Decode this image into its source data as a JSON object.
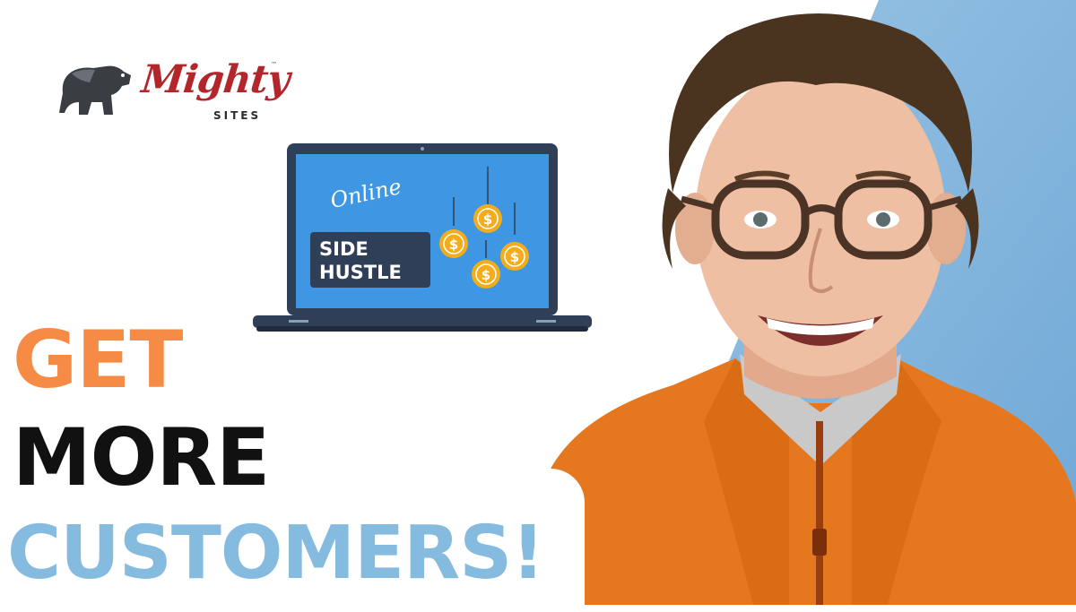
{
  "colors": {
    "brand_red": "#b3262b",
    "orange": "#f58b45",
    "black": "#111111",
    "light_blue": "#86bbe0",
    "screen_blue": "#3f97e3",
    "laptop_dark": "#2f3f57",
    "coin_gold": "#f3ad1c",
    "jacket_orange": "#e5781e"
  },
  "logo": {
    "word": "Mighty",
    "tm": "™",
    "sub": "SITES",
    "icon": "bear-icon"
  },
  "laptop": {
    "script_text": "Online",
    "badge_line1": "SIDE",
    "badge_line2": "HUSTLE",
    "coin_symbol": "$",
    "icon": "laptop-icon"
  },
  "headline": {
    "line1": "GET",
    "line2": "MORE",
    "line3": "CUSTOMERS!"
  }
}
